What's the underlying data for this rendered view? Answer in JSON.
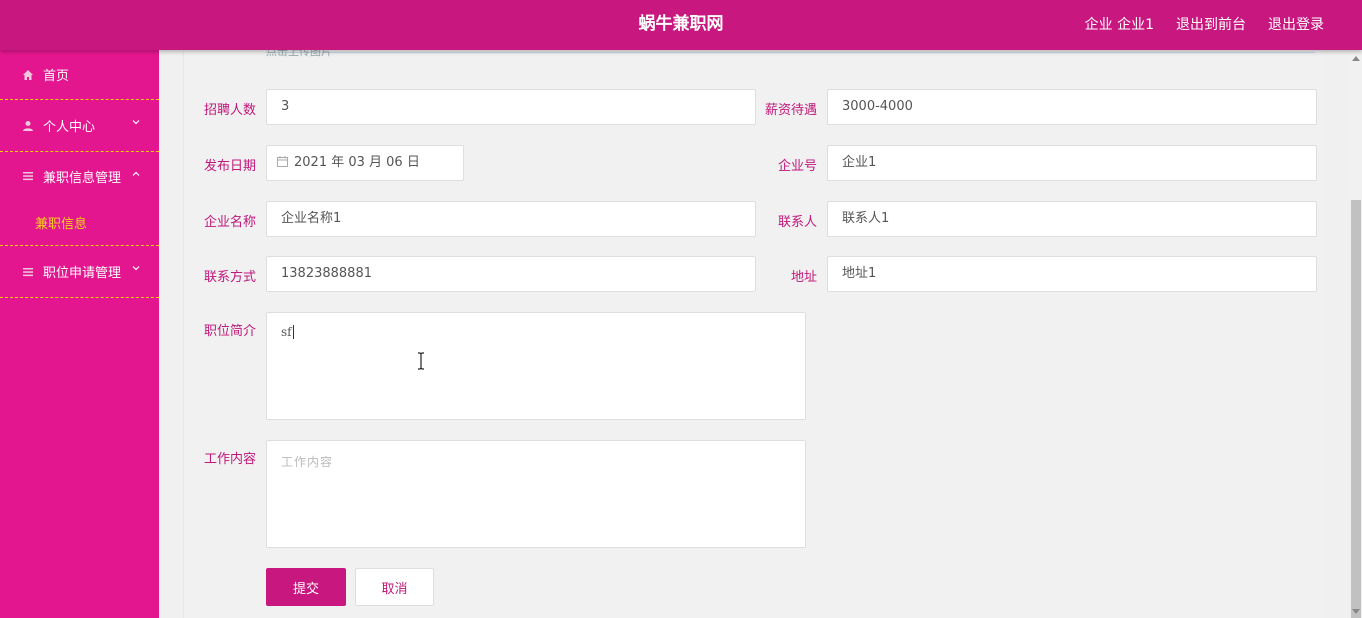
{
  "header": {
    "title": "蜗牛兼职网",
    "links": [
      "企业 企业1",
      "退出到前台",
      "退出登录"
    ]
  },
  "sidebar": {
    "items": [
      {
        "label": "首页",
        "icon": "home-icon"
      },
      {
        "label": "个人中心",
        "icon": "user-icon"
      },
      {
        "label": "兼职信息管理",
        "icon": "list-icon"
      },
      {
        "label": "兼职信息",
        "sub": true
      },
      {
        "label": "职位申请管理",
        "icon": "list-icon"
      }
    ]
  },
  "form": {
    "cut_text": "点击上传图片",
    "recruit_label": "招聘人数",
    "recruit_value": "3",
    "salary_label": "薪资待遇",
    "salary_value": "3000-4000",
    "date_label": "发布日期",
    "date_value": "2021 年 03 月 06 日",
    "company_no_label": "企业号",
    "company_no_value": "企业1",
    "company_name_label": "企业名称",
    "company_name_value": "企业名称1",
    "contact_label": "联系人",
    "contact_value": "联系人1",
    "phone_label": "联系方式",
    "phone_value": "13823888881",
    "address_label": "地址",
    "address_value": "地址1",
    "intro_label": "职位简介",
    "intro_value": "sf",
    "work_label": "工作内容",
    "work_placeholder": "工作内容",
    "submit_label": "提交",
    "cancel_label": "取消"
  },
  "colors": {
    "header_bg": "#c8177f",
    "sidebar_bg": "#e4168f",
    "accent_text": "#c0177a",
    "divider": "#f2d000",
    "active_sub": "#f7d21a"
  }
}
